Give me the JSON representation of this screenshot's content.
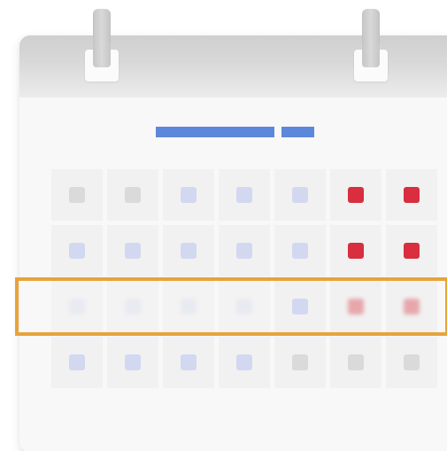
{
  "calendar": {
    "header_color": "#d3d3d3",
    "accent_color": "#5c88db",
    "highlight_color": "#e7a33b",
    "weeks": [
      [
        "grey",
        "grey",
        "blue",
        "blue",
        "blue",
        "red",
        "red"
      ],
      [
        "blue",
        "blue",
        "blue",
        "blue",
        "blue",
        "red",
        "red"
      ],
      [
        "blue-faded",
        "blue-faded",
        "blue-faded",
        "blue-faded",
        "blue",
        "red-faded",
        "red-faded"
      ],
      [
        "blue",
        "blue",
        "blue",
        "blue",
        "grey",
        "grey",
        "grey"
      ]
    ],
    "highlighted_week_index": 2
  }
}
